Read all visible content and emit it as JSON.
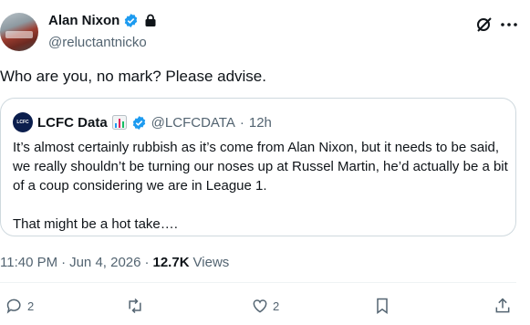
{
  "author": {
    "display_name": "Alan Nixon",
    "handle": "@reluctantnicko",
    "verified": true,
    "protected": true
  },
  "tweet": {
    "text": "Who are you, no mark? Please advise."
  },
  "quote": {
    "avatar_text": "LCFC",
    "display_name": "LCFC Data",
    "handle": "@LCFCDATA",
    "separator": "·",
    "time": "12h",
    "paragraph_1": "It’s almost certainly rubbish as it’s come from Alan Nixon, but it needs to be said, we really shouldn’t be turning our noses up at Russel Martin, he’d actually be a bit of a coup considering we are in League 1.",
    "paragraph_2": "That might be a hot take…."
  },
  "meta": {
    "time": "11:40 PM",
    "separator_1": "·",
    "date": "Jun 4, 2026",
    "separator_2": "·",
    "views_count": "12.7K",
    "views_label": "Views"
  },
  "actions": {
    "reply_count": "2",
    "like_count": "2"
  },
  "colors": {
    "verified_blue": "#1d9bf0",
    "text_primary": "#0f1419",
    "text_secondary": "#536471",
    "border": "#cfd9de"
  },
  "icons": [
    "verified-badge-icon",
    "lock-icon",
    "grok-icon",
    "more-icon",
    "chart-emoji-icon",
    "reply-icon",
    "retweet-icon",
    "like-icon",
    "bookmark-icon",
    "share-icon"
  ]
}
